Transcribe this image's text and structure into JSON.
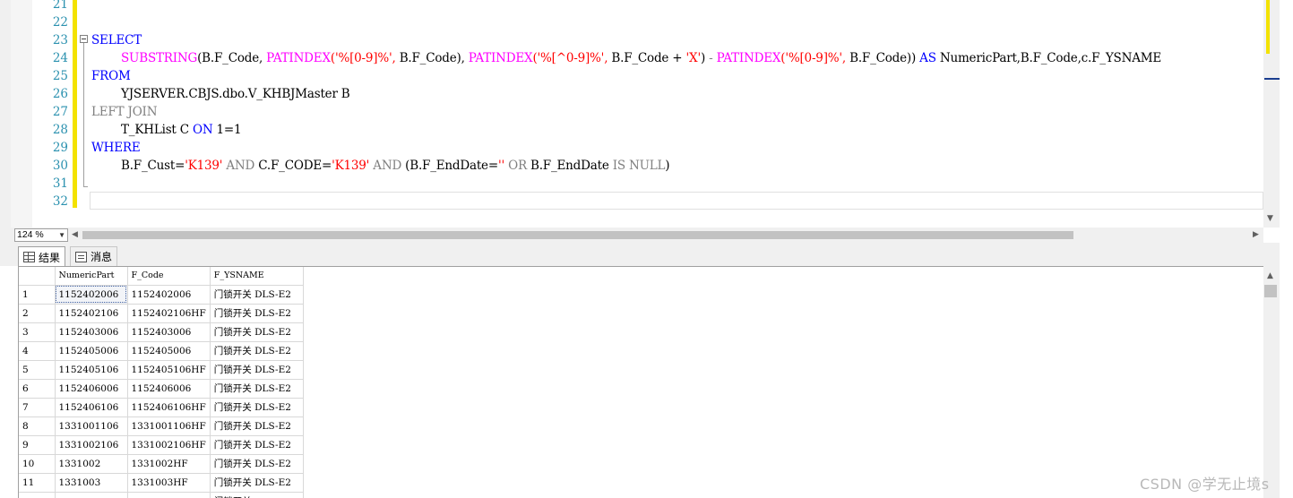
{
  "editor": {
    "line_numbers": [
      "21",
      "22",
      "23",
      "24",
      "25",
      "26",
      "27",
      "28",
      "29",
      "30",
      "31",
      "32"
    ],
    "code": {
      "l23_kw": "SELECT",
      "l24": [
        {
          "t": "SUBSTRING",
          "c": "fn"
        },
        {
          "t": "(B.F_Code, ",
          "c": ""
        },
        {
          "t": "PATINDEX",
          "c": "fn"
        },
        {
          "t": "('%[0-9]%', ",
          "c": "str"
        },
        {
          "t": "B.F_Code), ",
          "c": ""
        },
        {
          "t": "PATINDEX",
          "c": "fn"
        },
        {
          "t": "('%[^0-9]%', ",
          "c": "str"
        },
        {
          "t": "B.F_Code + ",
          "c": ""
        },
        {
          "t": "'X'",
          "c": "str"
        },
        {
          "t": ") ",
          "c": ""
        },
        {
          "t": "- ",
          "c": "gray"
        },
        {
          "t": "PATINDEX",
          "c": "fn"
        },
        {
          "t": "('%[0-9]%', ",
          "c": "str"
        },
        {
          "t": "B.F_Code)) ",
          "c": ""
        },
        {
          "t": "AS ",
          "c": "kw"
        },
        {
          "t": "NumericPart,B.F_Code,c.F_YSNAME",
          "c": ""
        }
      ],
      "l25_kw": "FROM",
      "l26": "YJSERVER.CBJS.dbo.V_KHBJMaster B",
      "l27_kw": "LEFT JOIN",
      "l28_a": "T_KHList C ",
      "l28_on": "ON ",
      "l28_b": "1=1",
      "l29_kw": "WHERE",
      "l30": [
        {
          "t": "B.F_Cust=",
          "c": ""
        },
        {
          "t": "'K139'",
          "c": "str"
        },
        {
          "t": " AND ",
          "c": "gray"
        },
        {
          "t": "C.F_CODE=",
          "c": ""
        },
        {
          "t": "'K139'",
          "c": "str"
        },
        {
          "t": " AND ",
          "c": "gray"
        },
        {
          "t": "(B.F_EndDate=",
          "c": ""
        },
        {
          "t": "''",
          "c": "str"
        },
        {
          "t": " OR ",
          "c": "gray"
        },
        {
          "t": "B.F_EndDate ",
          "c": ""
        },
        {
          "t": "IS NULL",
          "c": "gray"
        },
        {
          "t": ")",
          "c": ""
        }
      ]
    }
  },
  "zoom": "124 %",
  "tabs": {
    "results": "结果",
    "messages": "消息"
  },
  "grid": {
    "columns": [
      "",
      "NumericPart",
      "F_Code",
      "F_YSNAME"
    ],
    "rows": [
      [
        "1",
        "1152402006",
        "1152402006",
        "门锁开关 DLS-E2"
      ],
      [
        "2",
        "1152402106",
        "1152402106HF",
        "门锁开关 DLS-E2"
      ],
      [
        "3",
        "1152403006",
        "1152403006",
        "门锁开关 DLS-E2"
      ],
      [
        "4",
        "1152405006",
        "1152405006",
        "门锁开关 DLS-E2"
      ],
      [
        "5",
        "1152405106",
        "1152405106HF",
        "门锁开关 DLS-E2"
      ],
      [
        "6",
        "1152406006",
        "1152406006",
        "门锁开关 DLS-E2"
      ],
      [
        "7",
        "1152406106",
        "1152406106HF",
        "门锁开关 DLS-E2"
      ],
      [
        "8",
        "1331001106",
        "1331001106HF",
        "门锁开关 DLS-E2"
      ],
      [
        "9",
        "1331002106",
        "1331002106HF",
        "门锁开关 DLS-E2"
      ],
      [
        "10",
        "1331002",
        "1331002HF",
        "门锁开关 DLS-E2"
      ],
      [
        "11",
        "1331003",
        "1331003HF",
        "门锁开关 DLS-E2"
      ],
      [
        "",
        "",
        "",
        "门锁开关"
      ]
    ]
  },
  "watermark": "CSDN @学无止境s",
  "colors": {
    "keyword": "#0000ff",
    "function": "#ff00ff",
    "string": "#ff0000",
    "operator": "#808080",
    "line_number": "#2b91af",
    "change_bar": "#f3e200"
  }
}
